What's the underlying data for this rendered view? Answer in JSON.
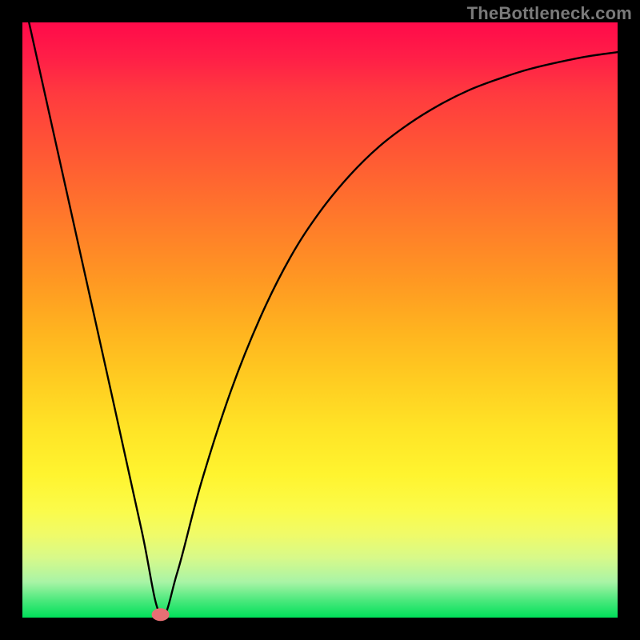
{
  "watermark": "TheBottleneck.com",
  "colors": {
    "top": "#ff0a4a",
    "bottom": "#00e05a",
    "curve": "#000000",
    "dot": "#e86f74",
    "frame": "#000000"
  },
  "chart_data": {
    "type": "line",
    "title": "",
    "xlabel": "",
    "ylabel": "",
    "xlim": [
      0,
      1
    ],
    "ylim": [
      0,
      1
    ],
    "series": [
      {
        "name": "bottleneck-curve",
        "x": [
          0.0,
          0.05,
          0.1,
          0.15,
          0.2,
          0.232,
          0.26,
          0.3,
          0.35,
          0.4,
          0.45,
          0.5,
          0.55,
          0.6,
          0.65,
          0.7,
          0.75,
          0.8,
          0.85,
          0.9,
          0.95,
          1.0
        ],
        "y": [
          1.05,
          0.825,
          0.6,
          0.375,
          0.148,
          0.005,
          0.075,
          0.225,
          0.38,
          0.505,
          0.605,
          0.682,
          0.743,
          0.792,
          0.83,
          0.861,
          0.886,
          0.905,
          0.921,
          0.933,
          0.943,
          0.95
        ]
      }
    ],
    "annotations": [
      {
        "type": "min-marker",
        "x": 0.232,
        "y": 0.005
      }
    ],
    "background_gradient": {
      "direction": "vertical",
      "stops": [
        {
          "pos": 0.0,
          "color": "#ff0a4a"
        },
        {
          "pos": 0.5,
          "color": "#ffb41f"
        },
        {
          "pos": 0.8,
          "color": "#fff42f"
        },
        {
          "pos": 1.0,
          "color": "#00e05a"
        }
      ]
    }
  }
}
